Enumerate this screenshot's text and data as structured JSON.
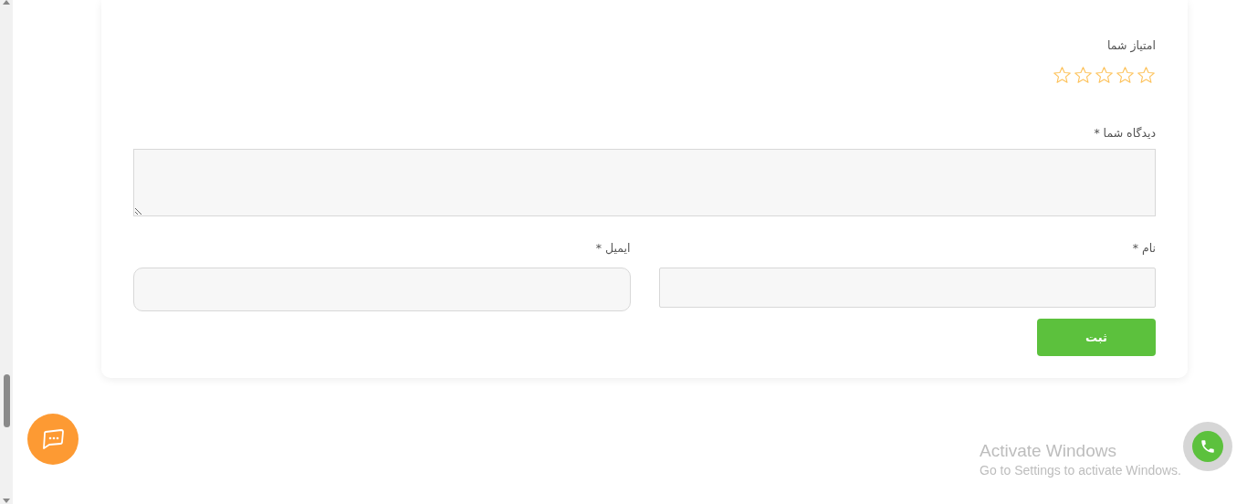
{
  "rating": {
    "label": "امتیاز شما",
    "stars": 0
  },
  "comment": {
    "label": "دیدگاه شما *"
  },
  "fields": [
    {
      "label": "نام *",
      "kind": "square"
    },
    {
      "label": "ایمیل *",
      "kind": "rounded"
    }
  ],
  "submit": "ثبت",
  "windows_notice": {
    "title": "Activate Windows",
    "subtitle": "Go to Settings to activate Windows."
  }
}
